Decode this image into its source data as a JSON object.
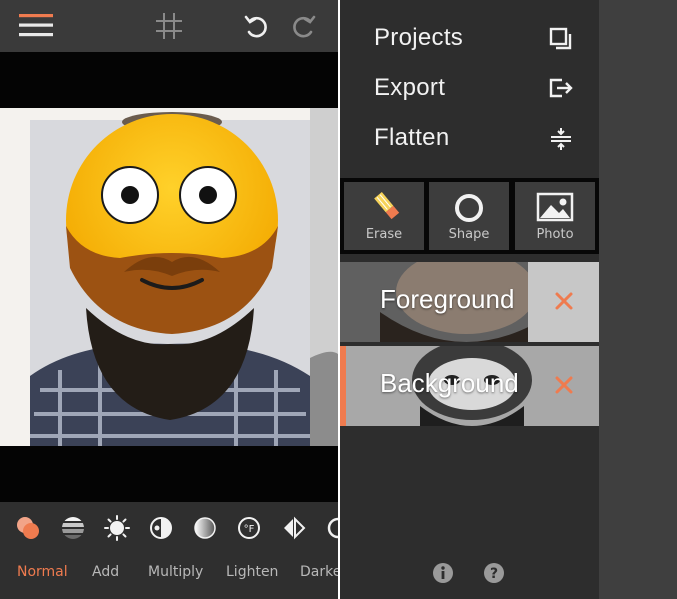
{
  "left_phone": {
    "toolbar": {
      "menu_icon": "hamburger-icon",
      "grid_icon": "grid-icon",
      "undo_icon": "undo-icon",
      "redo_icon": "redo-icon"
    },
    "adjust_icons": [
      "blend-icon",
      "stripes-icon",
      "brightness-icon",
      "contrast-icon",
      "gradient-icon",
      "temperature-icon",
      "flip-icon",
      "circle-icon"
    ],
    "blend_modes": [
      {
        "label": "Normal",
        "active": true
      },
      {
        "label": "Add",
        "active": false
      },
      {
        "label": "Multiply",
        "active": false
      },
      {
        "label": "Lighten",
        "active": false
      },
      {
        "label": "Darke",
        "active": false
      }
    ]
  },
  "right_phone": {
    "menu": [
      {
        "label": "Projects",
        "icon": "projects-icon"
      },
      {
        "label": "Export",
        "icon": "export-icon"
      },
      {
        "label": "Flatten",
        "icon": "flatten-icon"
      }
    ],
    "tools": [
      {
        "label": "Erase",
        "icon": "erase-icon"
      },
      {
        "label": "Shape",
        "icon": "shape-icon"
      },
      {
        "label": "Photo",
        "icon": "photo-icon"
      }
    ],
    "layers": [
      {
        "label": "Foreground",
        "selected": false
      },
      {
        "label": "Background",
        "selected": true
      }
    ],
    "footer_icons": [
      "info-icon",
      "help-icon"
    ]
  },
  "colors": {
    "accent": "#ef7b4f",
    "toolbar_bg": "#3a3a3a",
    "panel_bg": "#2d2d2d"
  }
}
